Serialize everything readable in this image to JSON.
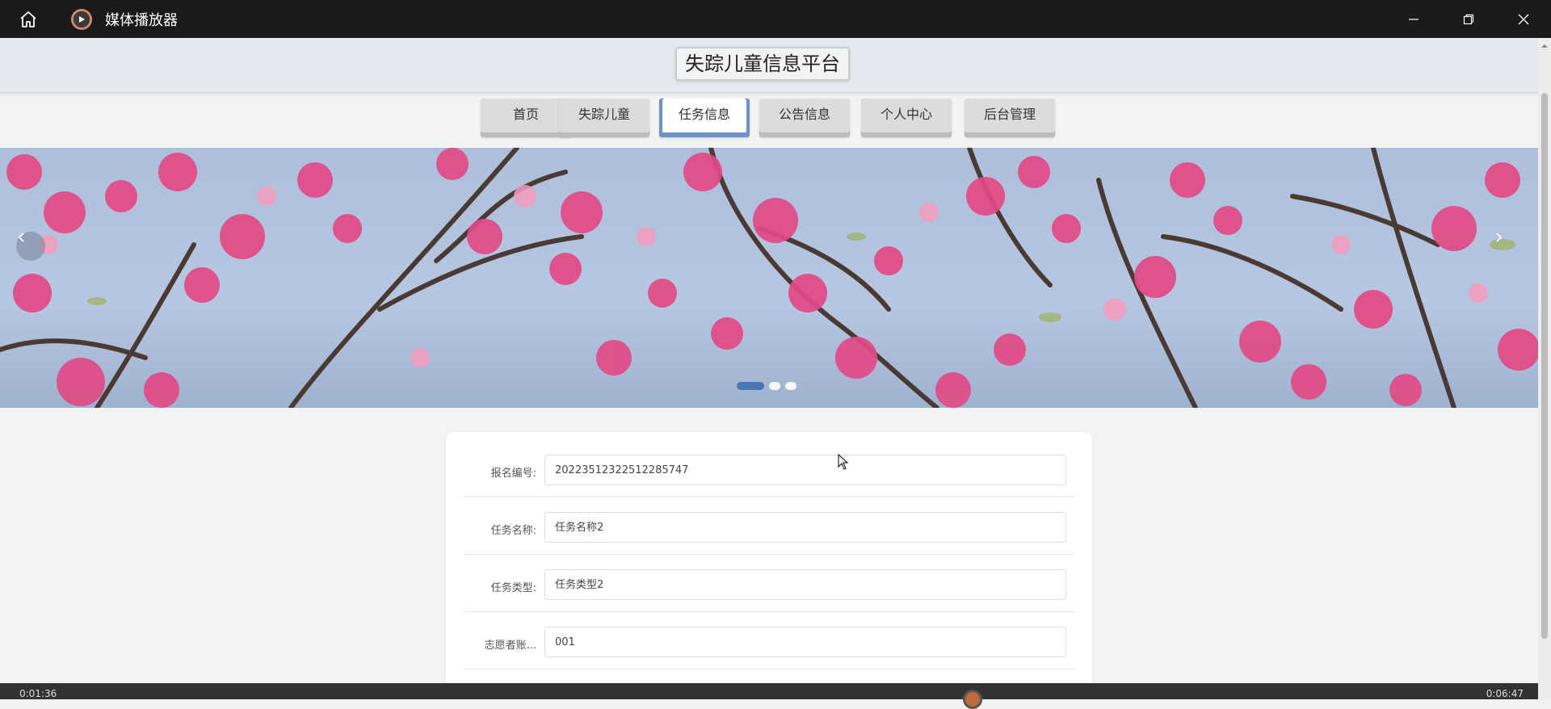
{
  "titlebar": {
    "app_title": "媒体播放器",
    "home_icon": "home-icon",
    "app_icon": "play-circle-icon",
    "controls": [
      "minimize-icon",
      "restore-icon",
      "close-icon"
    ]
  },
  "site": {
    "title": "失踪儿童信息平台"
  },
  "nav": {
    "items": [
      {
        "label": "首页"
      },
      {
        "label": "失踪儿童"
      },
      {
        "label": "任务信息",
        "active": true
      },
      {
        "label": "公告信息"
      },
      {
        "label": "个人中心"
      },
      {
        "label": "后台管理"
      }
    ]
  },
  "banner": {
    "slide_count": 3,
    "active_slide": 1,
    "prev_icon": "chevron-left-icon",
    "next_icon": "chevron-right-icon"
  },
  "form": {
    "fields": [
      {
        "label": "报名编号:",
        "value": "20223512322512285747"
      },
      {
        "label": "任务名称:",
        "value": "任务名称2"
      },
      {
        "label": "任务类型:",
        "value": "任务类型2"
      },
      {
        "label": "志愿者账...",
        "value": "001"
      }
    ]
  },
  "mediabar": {
    "elapsed": "0:01:36",
    "remaining": "0:06:47"
  },
  "colors": {
    "titlebar_bg": "#1a1a1a",
    "header_bg": "#e3e8ee",
    "nav_active_accent": "#6d93c8",
    "dot_active": "#3f6fb0",
    "card_bg": "#ffffff"
  }
}
